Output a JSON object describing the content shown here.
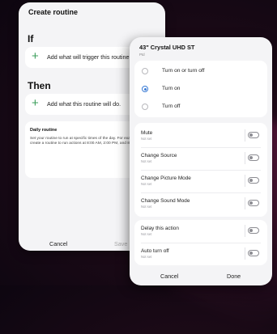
{
  "routine": {
    "title": "Create routine",
    "if_label": "If",
    "if_action": "Add what will trigger this routine",
    "then_label": "Then",
    "then_action": "Add what this routine will do.",
    "daily_title": "Daily routine",
    "daily_body": "Set your routine to run at specific times of the day. For example, you can create a routine to run actions at 8:00 AM, 2:00 PM, and 8:00 PM.",
    "cancel": "Cancel",
    "save": "Save"
  },
  "device": {
    "title": "43\" Crystal UHD ST",
    "subtitle": "Ptd",
    "power_options": [
      "Turn on or turn off",
      "Turn on",
      "Turn off"
    ],
    "selected_power": "Turn on",
    "settings": [
      {
        "label": "Mute",
        "sub": "Not set"
      },
      {
        "label": "Change Source",
        "sub": "Not set"
      },
      {
        "label": "Change Picture Mode",
        "sub": "Not set"
      },
      {
        "label": "Change Sound Mode",
        "sub": "Not set"
      }
    ],
    "extras": [
      {
        "label": "Delay this action",
        "sub": "Not set"
      },
      {
        "label": "Auto turn off",
        "sub": "Not set"
      }
    ],
    "cancel": "Cancel",
    "done": "Done"
  },
  "colors": {
    "accent": "#3a7bd5",
    "plus_green": "#3b9e5b"
  }
}
